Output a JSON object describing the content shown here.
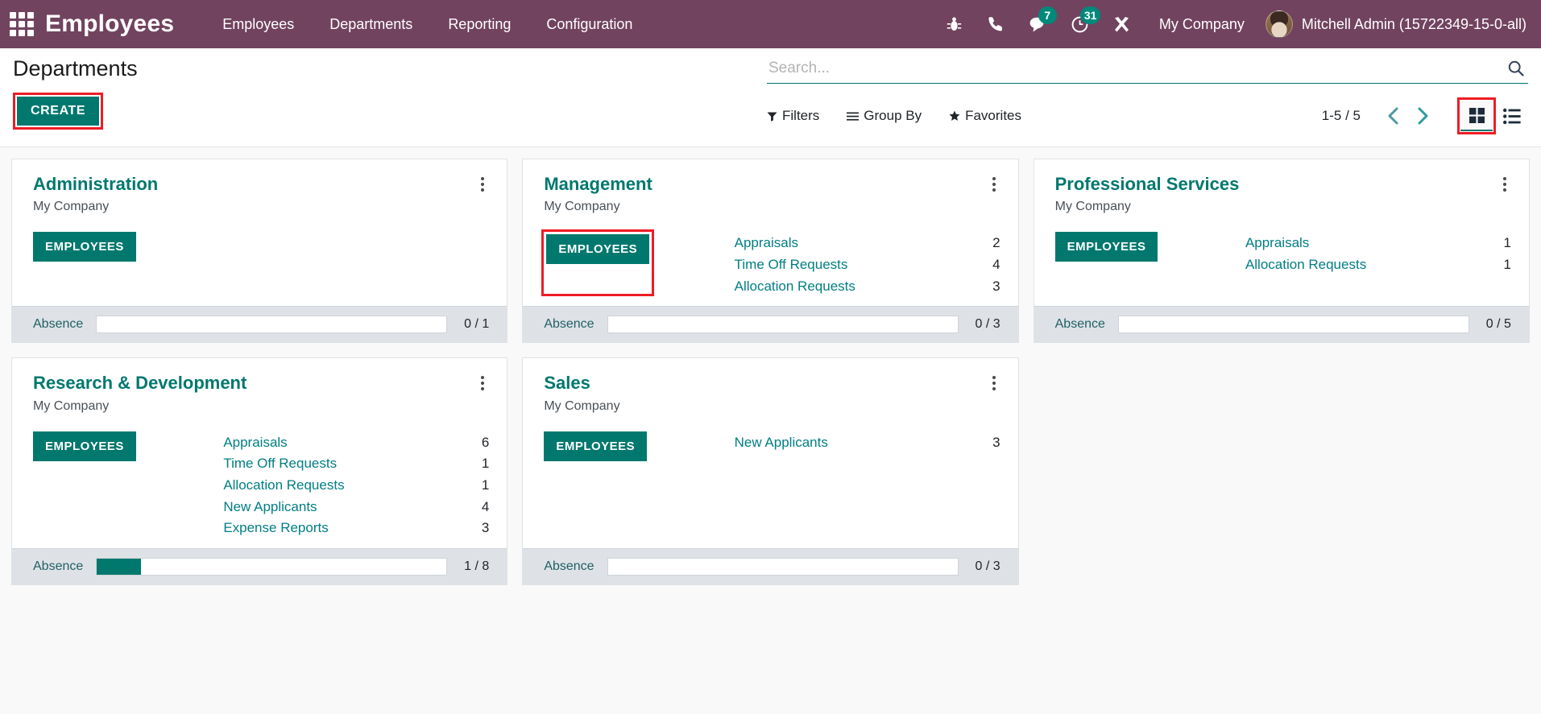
{
  "navbar": {
    "apps_icon": "apps-grid-icon",
    "brand": "Employees",
    "menu": [
      {
        "label": "Employees"
      },
      {
        "label": "Departments"
      },
      {
        "label": "Reporting"
      },
      {
        "label": "Configuration"
      }
    ],
    "sys_icons": [
      {
        "name": "bug-icon",
        "badge": ""
      },
      {
        "name": "phone-icon",
        "badge": ""
      },
      {
        "name": "messages-icon",
        "badge": "7"
      },
      {
        "name": "activities-clock-icon",
        "badge": "31"
      },
      {
        "name": "tools-icon",
        "badge": ""
      }
    ],
    "company": "My Company",
    "user": "Mitchell Admin (15722349-15-0-all)"
  },
  "control_panel": {
    "title": "Departments",
    "create_label": "CREATE",
    "search_placeholder": "Search...",
    "search_value": "",
    "filters_label": "Filters",
    "group_by_label": "Group By",
    "favorites_label": "Favorites",
    "pager": "1-5 / 5",
    "prev_icon": "chevron-left-icon",
    "next_icon": "chevron-right-icon",
    "kanban_view_icon": "kanban-view-icon",
    "list_view_icon": "list-view-icon",
    "active_view": "kanban"
  },
  "colors": {
    "navbar_purple": "#71435F",
    "accent_teal": "#00786E",
    "highlight_red": "#EE1C25",
    "badge_teal": "#00887A",
    "footer_gray": "#dee2e6"
  },
  "cards": [
    {
      "title": "Administration",
      "company": "My Company",
      "employees_label": "EMPLOYEES",
      "employees_highlighted": false,
      "stats": [],
      "absence_label": "Absence",
      "absence_count": "0 / 1",
      "absence_percent": 0
    },
    {
      "title": "Management",
      "company": "My Company",
      "employees_label": "EMPLOYEES",
      "employees_highlighted": true,
      "stats": [
        {
          "label": "Appraisals",
          "value": "2"
        },
        {
          "label": "Time Off Requests",
          "value": "4"
        },
        {
          "label": "Allocation Requests",
          "value": "3"
        }
      ],
      "absence_label": "Absence",
      "absence_count": "0 / 3",
      "absence_percent": 0
    },
    {
      "title": "Professional Services",
      "company": "My Company",
      "employees_label": "EMPLOYEES",
      "employees_highlighted": false,
      "stats": [
        {
          "label": "Appraisals",
          "value": "1"
        },
        {
          "label": "Allocation Requests",
          "value": "1"
        }
      ],
      "absence_label": "Absence",
      "absence_count": "0 / 5",
      "absence_percent": 0
    },
    {
      "title": "Research & Development",
      "company": "My Company",
      "employees_label": "EMPLOYEES",
      "employees_highlighted": false,
      "stats": [
        {
          "label": "Appraisals",
          "value": "6"
        },
        {
          "label": "Time Off Requests",
          "value": "1"
        },
        {
          "label": "Allocation Requests",
          "value": "1"
        },
        {
          "label": "New Applicants",
          "value": "4"
        },
        {
          "label": "Expense Reports",
          "value": "3"
        }
      ],
      "absence_label": "Absence",
      "absence_count": "1 / 8",
      "absence_percent": 12.5
    },
    {
      "title": "Sales",
      "company": "My Company",
      "employees_label": "EMPLOYEES",
      "employees_highlighted": false,
      "stats": [
        {
          "label": "New Applicants",
          "value": "3"
        }
      ],
      "absence_label": "Absence",
      "absence_count": "0 / 3",
      "absence_percent": 0
    }
  ]
}
